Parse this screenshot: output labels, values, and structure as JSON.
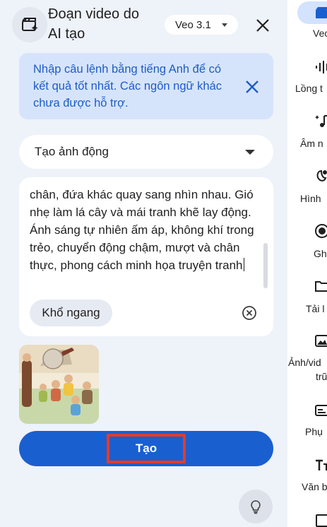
{
  "header": {
    "title": "Đoạn video do AI tạo",
    "model": "Veo 3.1",
    "icons": {
      "clip": "clapperboard-sparkle-icon",
      "close": "close-icon"
    }
  },
  "info_banner": {
    "text": "Nhập câu lệnh bằng tiếng Anh để có kết quả tốt nhất. Các ngôn ngữ khác chưa được hỗ trợ."
  },
  "mode_select": {
    "value": "Tạo ảnh động"
  },
  "prompt": {
    "text": "chân, đứa khác quay sang nhìn nhau. Gió nhẹ làm lá cây và mái tranh khẽ lay động. Ánh sáng tự nhiên ấm áp, không khí trong trẻo, chuyển động chậm, mượt và chân thực, phong cách minh họa truyện tranh",
    "aspect_chip": "Khổ ngang"
  },
  "generate_label": "Tạo",
  "rail": {
    "items": [
      {
        "label": "Vec",
        "icon": "video-clip-icon"
      },
      {
        "label": "Lồng t",
        "icon": "voice-waveform-icon"
      },
      {
        "label": "Âm n",
        "icon": "music-note-icon"
      },
      {
        "label": "Hình",
        "icon": "sticker-icon"
      },
      {
        "label": "Gh",
        "icon": "record-icon"
      },
      {
        "label": "Tải l",
        "icon": "folder-icon"
      },
      {
        "label": "Ảnh/vid",
        "icon": "image-video-icon"
      },
      {
        "label": "trũ",
        "icon": ""
      },
      {
        "label": "Phụ",
        "icon": "captions-icon"
      },
      {
        "label": "Văn b",
        "icon": "text-icon"
      }
    ]
  },
  "colors": {
    "accent": "#1a5fd0",
    "highlight": "#e23b2e",
    "panel": "#eef2f9",
    "banner": "#d6e4fb"
  }
}
